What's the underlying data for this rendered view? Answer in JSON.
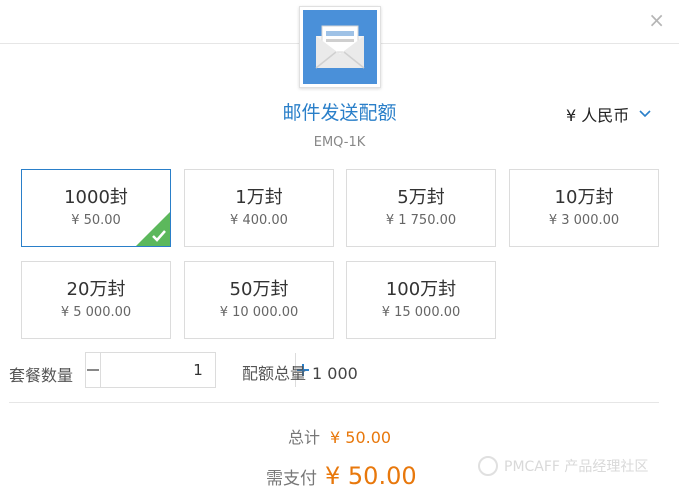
{
  "header": {
    "close_glyph": "×"
  },
  "product": {
    "title": "邮件发送配额",
    "sku": "EMQ-1K"
  },
  "currency": {
    "label": "¥ 人民币"
  },
  "plans": [
    {
      "name": "1000封",
      "price": "¥ 50.00",
      "selected": true
    },
    {
      "name": "1万封",
      "price": "¥ 400.00",
      "selected": false
    },
    {
      "name": "5万封",
      "price": "¥ 1 750.00",
      "selected": false
    },
    {
      "name": "10万封",
      "price": "¥ 3 000.00",
      "selected": false
    },
    {
      "name": "20万封",
      "price": "¥ 5 000.00",
      "selected": false
    },
    {
      "name": "50万封",
      "price": "¥ 10 000.00",
      "selected": false
    },
    {
      "name": "100万封",
      "price": "¥ 15 000.00",
      "selected": false
    }
  ],
  "quantity": {
    "label": "套餐数量",
    "value": "1"
  },
  "quota": {
    "label": "配额总量",
    "value": "1 000"
  },
  "total": {
    "label": "总计",
    "value": "¥ 50.00"
  },
  "pay": {
    "label": "需支付",
    "value": "¥ 50.00"
  },
  "watermark": {
    "text": "PMCAFF 产品经理社区"
  },
  "colors": {
    "accent": "#2a7fc9",
    "price": "#e8780c",
    "check": "#5cb85c"
  }
}
